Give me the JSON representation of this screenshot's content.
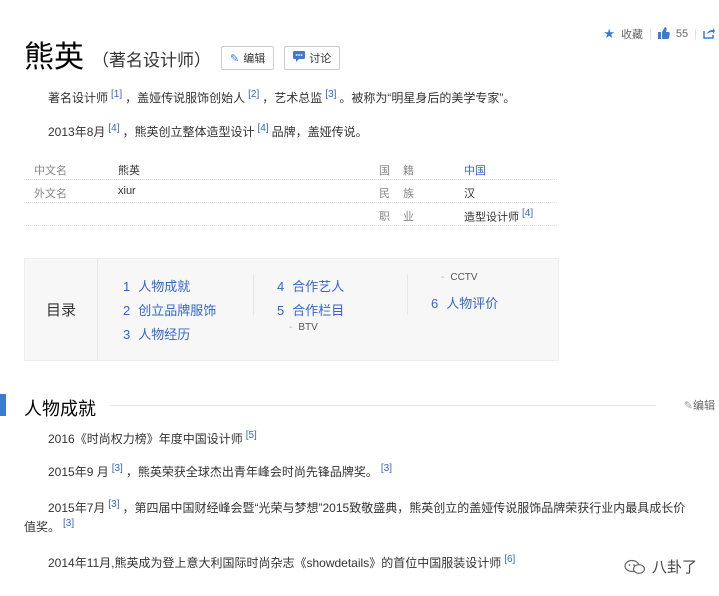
{
  "topbar": {
    "collect_label": "收藏",
    "like_count": "55"
  },
  "header": {
    "title": "熊英",
    "subtitle": "（著名设计师）",
    "edit_label": "编辑",
    "discuss_label": "讨论"
  },
  "intro": {
    "line1_a": "著名设计师",
    "ref1": "[1]",
    "line1_b": "，盖娅传说服饰创始人",
    "ref2": "[2]",
    "line1_c": "，艺术总监",
    "ref3": "[3]",
    "line1_d": "。被称为“明星身后的美学专家”。",
    "line2_a": "2013年8月",
    "ref4": "[4]",
    "line2_b": "，熊英创立整体造型设计",
    "ref5": "[4]",
    "line2_c": "品牌，盖娅传说。"
  },
  "info": {
    "rows": [
      {
        "k1": "中文名",
        "v1": "熊英",
        "k2": "国　籍",
        "v2": "中国"
      },
      {
        "k1": "外文名",
        "v1": "xiur",
        "k2": "民　族",
        "v2": "汉"
      },
      {
        "k1": "",
        "v1": "",
        "k2": "职　业",
        "v2": "造型设计师",
        "ref": "[4]"
      }
    ]
  },
  "toc": {
    "label": "目录",
    "items": [
      {
        "n": "1",
        "label": "人物成就"
      },
      {
        "n": "2",
        "label": "创立品牌服饰"
      },
      {
        "n": "3",
        "label": "人物经历"
      },
      {
        "n": "4",
        "label": "合作艺人"
      },
      {
        "n": "5",
        "label": "合作栏目"
      },
      {
        "n": "6",
        "label": "人物评价"
      }
    ],
    "subs": [
      "BTV",
      "CCTV"
    ]
  },
  "section": {
    "title": "人物成就",
    "edit_label": "编辑",
    "entries": [
      {
        "text": "2016《时尚权力榜》年度中国设计师",
        "ref": "[5]"
      },
      {
        "a": "2015年9 月",
        "ref1": "[3]",
        "b": "，熊英荣获全球杰出青年峰会时尚先锋品牌奖。",
        "ref2": "[3]"
      },
      {
        "a": "2015年7月",
        "ref1": "[3]",
        "b": "，第四届中国财经峰会暨“光荣与梦想”2015致敬盛典，熊英创立的盖娅传说服饰品牌荣获行业内最具成长价",
        "c": "值奖。",
        "ref2": "[3]"
      },
      {
        "text": "2014年11月,熊英成为登上意大利国际时尚杂志《showdetails》的首位中国服装设计师",
        "ref": "[6]"
      }
    ]
  },
  "watermark": {
    "text": "八卦了"
  }
}
